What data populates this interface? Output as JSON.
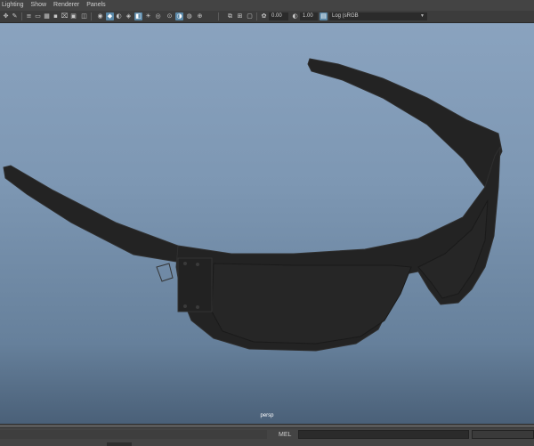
{
  "menu": {
    "items": [
      "Lighting",
      "Show",
      "Renderer",
      "Panels"
    ]
  },
  "toolbar": {
    "icons": [
      "move-camera-icon",
      "paint-icon",
      "menu-list-icon",
      "film-icon",
      "grid-icon",
      "dot-icon",
      "camera-lock-icon",
      "wireframe-icon",
      "smooth-shade-icon",
      "textured-icon",
      "lights-icon",
      "shadows-icon",
      "ambient-occlusion-icon",
      "motion-blur-icon",
      "isolate-icon",
      "xray-icon",
      "xray-joints-icon",
      "image-plane-icon",
      "resolution-gate-icon",
      "gate-mask-icon",
      "field-chart-icon",
      "gamma-icon",
      "exposure-icon",
      "colorspace-icon"
    ],
    "exposure_value": "0.00",
    "gamma_value": "1.00",
    "colorspace_label": "Log (sRGB"
  },
  "viewport": {
    "camera_label": "persp",
    "background_top": "#8aa3bf",
    "background_bottom": "#4a6078",
    "object_color": "#232323"
  },
  "command_line": {
    "language_label": "MEL",
    "input_value": "",
    "result_value": ""
  }
}
